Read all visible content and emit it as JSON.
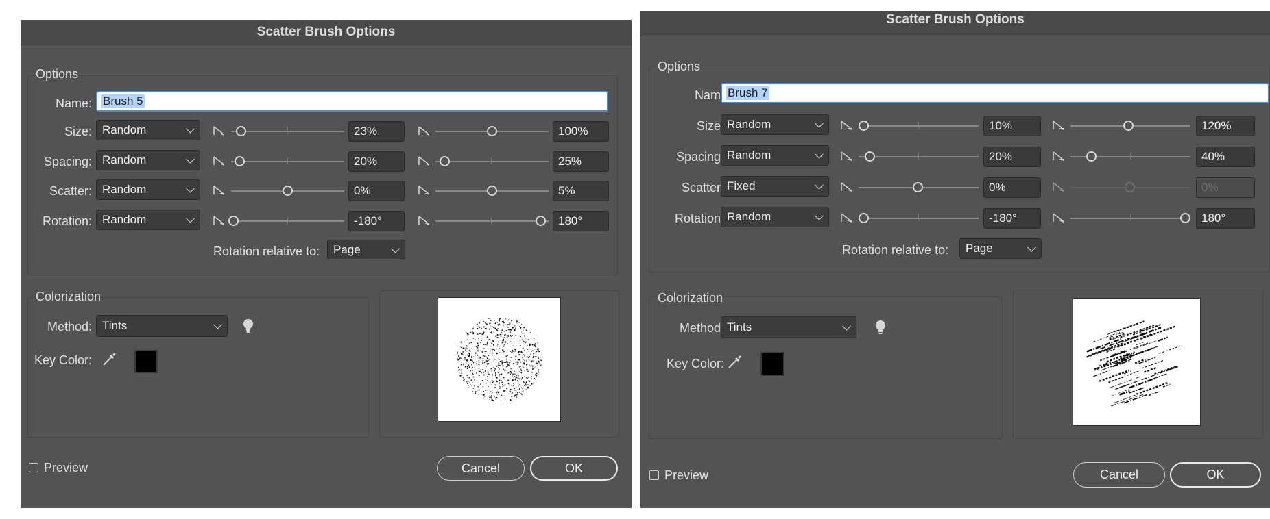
{
  "dialogs": [
    {
      "title": "Scatter Brush Options",
      "options_label": "Options",
      "name_label": "Name:",
      "name_value": "Brush 5",
      "rows": [
        {
          "label": "Size:",
          "mode": "Random",
          "min_value": "23%",
          "max_value": "100%"
        },
        {
          "label": "Spacing:",
          "mode": "Random",
          "min_value": "20%",
          "max_value": "25%"
        },
        {
          "label": "Scatter:",
          "mode": "Random",
          "min_value": "0%",
          "max_value": "5%"
        },
        {
          "label": "Rotation:",
          "mode": "Random",
          "min_value": "-180°",
          "max_value": "180°"
        }
      ],
      "rotation_relative_label": "Rotation relative to:",
      "rotation_relative_value": "Page",
      "colorization_label": "Colorization",
      "method_label": "Method:",
      "method_value": "Tints",
      "key_color_label": "Key Color:",
      "key_color": "#000000",
      "preview_label": "Preview",
      "preview_checked": false,
      "cancel_label": "Cancel",
      "ok_label": "OK"
    },
    {
      "title": "Scatter Brush Options",
      "options_label": "Options",
      "name_label": "Name:",
      "name_value": "Brush 7",
      "rows": [
        {
          "label": "Size:",
          "mode": "Random",
          "min_value": "10%",
          "max_value": "120%"
        },
        {
          "label": "Spacing:",
          "mode": "Random",
          "min_value": "20%",
          "max_value": "40%"
        },
        {
          "label": "Scatter:",
          "mode": "Fixed",
          "min_value": "0%",
          "max_value": "0%"
        },
        {
          "label": "Rotation:",
          "mode": "Random",
          "min_value": "-180°",
          "max_value": "180°"
        }
      ],
      "rotation_relative_label": "Rotation relative to:",
      "rotation_relative_value": "Page",
      "colorization_label": "Colorization",
      "method_label": "Method:",
      "method_value": "Tints",
      "key_color_label": "Key Color:",
      "key_color": "#000000",
      "preview_label": "Preview",
      "preview_checked": false,
      "cancel_label": "Cancel",
      "ok_label": "OK"
    }
  ]
}
